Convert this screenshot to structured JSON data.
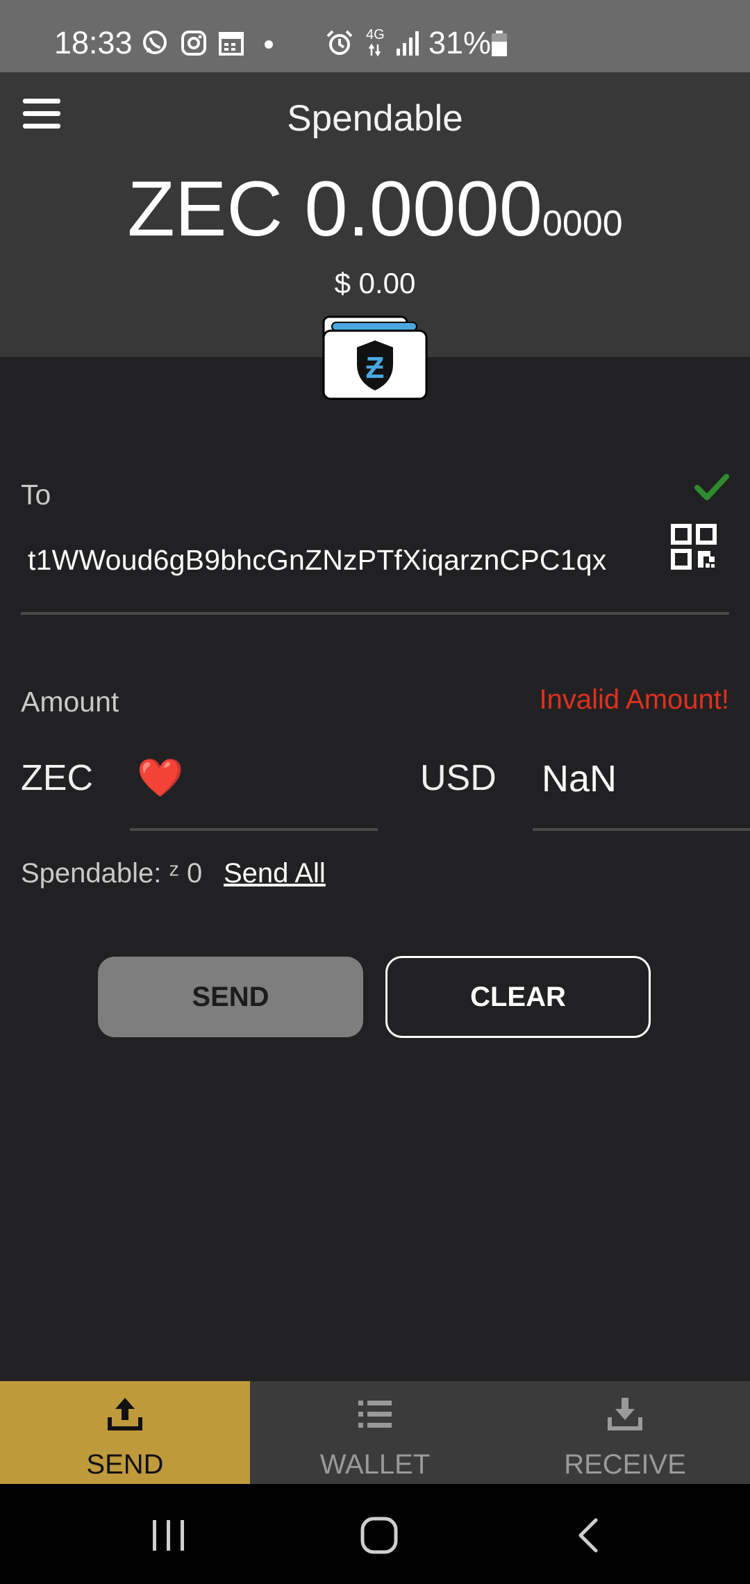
{
  "status_bar": {
    "time": "18:33",
    "network": "4G",
    "battery": "31%",
    "icons": [
      "whatsapp-icon",
      "instagram-icon",
      "calendar-icon",
      "dot-icon",
      "alarm-icon",
      "4g-icon",
      "signal-icon",
      "battery-icon"
    ]
  },
  "header": {
    "title": "Spendable",
    "balance_main": "ZEC 0.0000",
    "balance_small": "0000",
    "balance_usd": "$ 0.00"
  },
  "to": {
    "label": "To",
    "address": "t1WWoud6gB9bhcGnZNzPTfXiqarznCPC1qx",
    "valid": true
  },
  "amount": {
    "label": "Amount",
    "error": "Invalid Amount!",
    "zec_label": "ZEC",
    "zec_value": "❤️",
    "usd_label": "USD",
    "usd_value": "NaN"
  },
  "spendable_text": "Spendable: ᶻ 0",
  "send_all_label": "Send All",
  "buttons": {
    "send": "SEND",
    "clear": "CLEAR"
  },
  "tabs": [
    {
      "label": "SEND",
      "icon": "upload-icon",
      "active": true
    },
    {
      "label": "WALLET",
      "icon": "list-icon",
      "active": false
    },
    {
      "label": "RECEIVE",
      "icon": "download-icon",
      "active": false
    }
  ],
  "colors": {
    "accent_gold": "#bf9a3c",
    "error_red": "#e0301e",
    "valid_green": "#2e8b2e",
    "background": "#212123",
    "header_bg": "#383838",
    "zcash_blue": "#4aa8e0"
  }
}
